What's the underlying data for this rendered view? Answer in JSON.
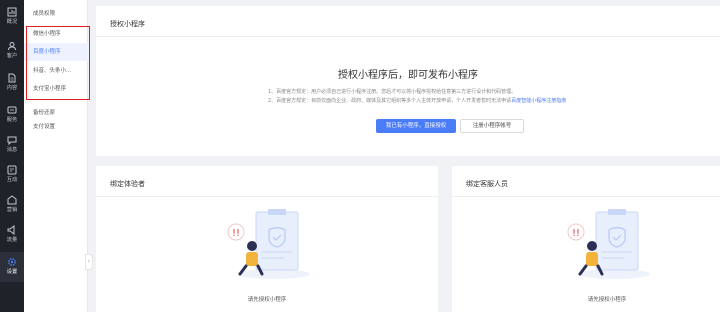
{
  "rail": {
    "items": [
      {
        "label": "概况",
        "icon": "overview-icon"
      },
      {
        "label": "客户",
        "icon": "customer-icon"
      },
      {
        "label": "内容",
        "icon": "content-icon"
      },
      {
        "label": "服务",
        "icon": "service-icon"
      },
      {
        "label": "消息",
        "icon": "message-icon"
      },
      {
        "label": "互动",
        "icon": "interaction-icon"
      },
      {
        "label": "营销",
        "icon": "marketing-icon"
      },
      {
        "label": "流量",
        "icon": "traffic-icon"
      },
      {
        "label": "设置",
        "icon": "settings-icon"
      }
    ]
  },
  "submenu": {
    "items": [
      {
        "label": "成员权限"
      },
      {
        "label": "微信小程序"
      },
      {
        "label": "百度小程序"
      },
      {
        "label": "抖音、头条小..."
      },
      {
        "label": "支付宝小程序"
      },
      {
        "label": "备份还原"
      },
      {
        "label": "支付设置"
      }
    ]
  },
  "authorize": {
    "header": "授权小程序",
    "title": "授权小程序后，即可发布小程序",
    "notice_1": "1、百度官方规定：用户必须自己进行小程序注册。您后才可以将小程序授权给任意第三方进行设计和代码管理。",
    "notice_2_prefix": "2、百度官方规定：目前仅面向企业、政府、媒体及其它组织等多个入主体开放申请，个人开发者暂时无法申请",
    "notice_2_link": "百度智能小程序注册指南",
    "primary_button": "我已有小程序，直接授权",
    "secondary_button": "注册小程序帐号"
  },
  "experience": {
    "header": "绑定体验者",
    "empty_text": "请先授权小程序"
  },
  "service": {
    "header": "绑定客服人员",
    "empty_text": "请先授权小程序"
  },
  "colors": {
    "accent": "#4a7cf7",
    "rail_bg": "#1f2329",
    "highlight_border": "#e02020"
  }
}
